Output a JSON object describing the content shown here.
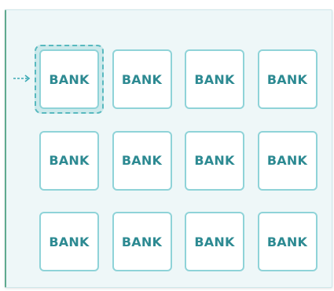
{
  "colors": {
    "panel_bg": "#eef7f8",
    "tile_border": "#8fd3d8",
    "label_color": "#2d8a92",
    "selection_accent": "#58b9bf",
    "arrow_color": "#3aa9b4"
  },
  "icons": {
    "pointer": "arrow-right-icon"
  },
  "selected_index": 0,
  "tiles": [
    {
      "label": "BANK"
    },
    {
      "label": "BANK"
    },
    {
      "label": "BANK"
    },
    {
      "label": "BANK"
    },
    {
      "label": "BANK"
    },
    {
      "label": "BANK"
    },
    {
      "label": "BANK"
    },
    {
      "label": "BANK"
    },
    {
      "label": "BANK"
    },
    {
      "label": "BANK"
    },
    {
      "label": "BANK"
    },
    {
      "label": "BANK"
    }
  ]
}
